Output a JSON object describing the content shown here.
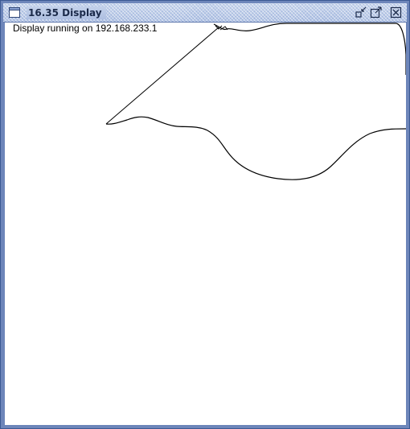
{
  "window": {
    "title": "16.35 Display",
    "buttons": {
      "minimize_icon": "minimize-icon",
      "maximize_icon": "maximize-icon",
      "close_icon": "close-icon"
    }
  },
  "content": {
    "status_text": "Display running on 192.168.233.1"
  },
  "colors": {
    "frame": "#6d86ba",
    "titlebar": "#a9bde2",
    "canvas": "#ffffff",
    "stroke": "#000000"
  }
}
